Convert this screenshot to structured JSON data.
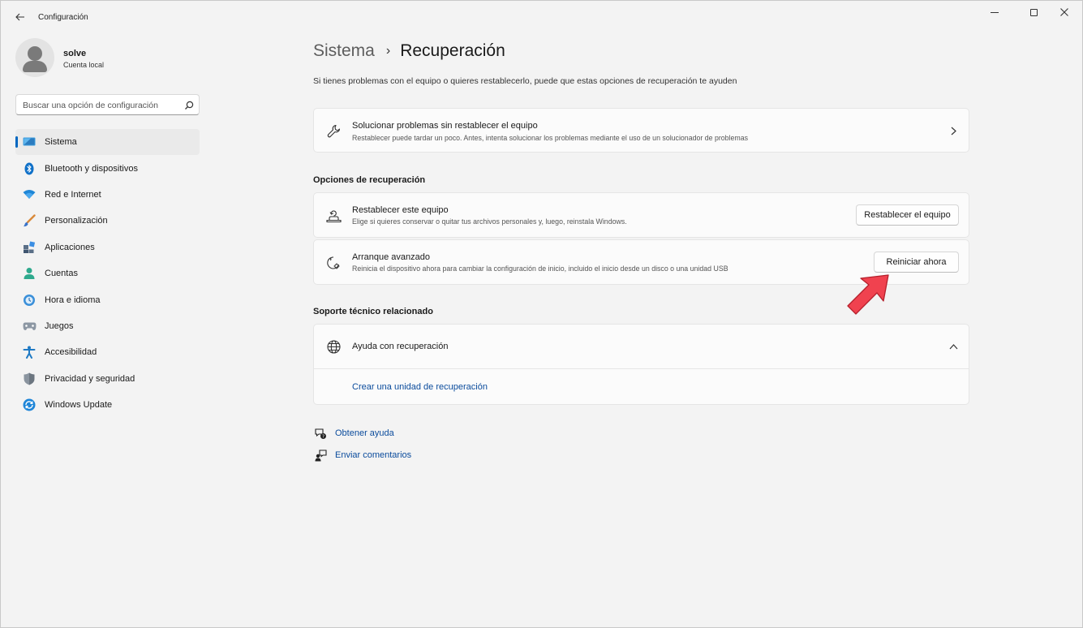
{
  "window": {
    "title": "Configuración",
    "back_icon": "back-arrow-icon",
    "minimize_icon": "minimize-icon",
    "maximize_icon": "maximize-icon",
    "close_icon": "close-icon"
  },
  "user": {
    "name": "solve",
    "account_type": "Cuenta local",
    "avatar_icon": "user-avatar-icon"
  },
  "search": {
    "placeholder": "Buscar una opción de configuración",
    "icon": "search-icon"
  },
  "sidebar": {
    "active_index": 0,
    "items": [
      {
        "label": "Sistema",
        "icon": "system-display-icon"
      },
      {
        "label": "Bluetooth y dispositivos",
        "icon": "bluetooth-icon"
      },
      {
        "label": "Red e Internet",
        "icon": "wifi-icon"
      },
      {
        "label": "Personalización",
        "icon": "paintbrush-icon"
      },
      {
        "label": "Aplicaciones",
        "icon": "apps-icon"
      },
      {
        "label": "Cuentas",
        "icon": "account-icon"
      },
      {
        "label": "Hora e idioma",
        "icon": "time-language-icon"
      },
      {
        "label": "Juegos",
        "icon": "gamepad-icon"
      },
      {
        "label": "Accesibilidad",
        "icon": "accessibility-icon"
      },
      {
        "label": "Privacidad y seguridad",
        "icon": "shield-icon"
      },
      {
        "label": "Windows Update",
        "icon": "windows-update-icon"
      }
    ]
  },
  "breadcrumb": {
    "parent": "Sistema",
    "separator": "›",
    "current": "Recuperación"
  },
  "page_description": "Si tienes problemas con el equipo o quieres restablecerlo, puede que estas opciones de recuperación te ayuden",
  "troubleshoot_card": {
    "title": "Solucionar problemas sin restablecer el equipo",
    "description": "Restablecer puede tardar un poco. Antes, intenta solucionar los problemas mediante el uso de un solucionador de problemas",
    "icon": "wrench-icon"
  },
  "recovery_options": {
    "heading": "Opciones de recuperación",
    "items": [
      {
        "title": "Restablecer este equipo",
        "description": "Elige si quieres conservar o quitar tus archivos personales y, luego, reinstala Windows.",
        "button": "Restablecer el equipo",
        "icon": "reset-pc-icon"
      },
      {
        "title": "Arranque avanzado",
        "description": "Reinicia el dispositivo ahora para cambiar la configuración de inicio, incluido el inicio desde un disco o una unidad USB",
        "button": "Reiniciar ahora",
        "icon": "advanced-startup-icon"
      }
    ]
  },
  "related_support": {
    "heading": "Soporte técnico relacionado",
    "item_title": "Ayuda con recuperación",
    "item_icon": "globe-icon",
    "expanded": true,
    "link": "Crear una unidad de recuperación"
  },
  "footer_links": [
    {
      "label": "Obtener ayuda",
      "icon": "get-help-icon"
    },
    {
      "label": "Enviar comentarios",
      "icon": "feedback-icon"
    }
  ],
  "colors": {
    "accent": "#0067c0",
    "link": "#0a4b9c",
    "annotation_arrow": "#f0424f"
  }
}
